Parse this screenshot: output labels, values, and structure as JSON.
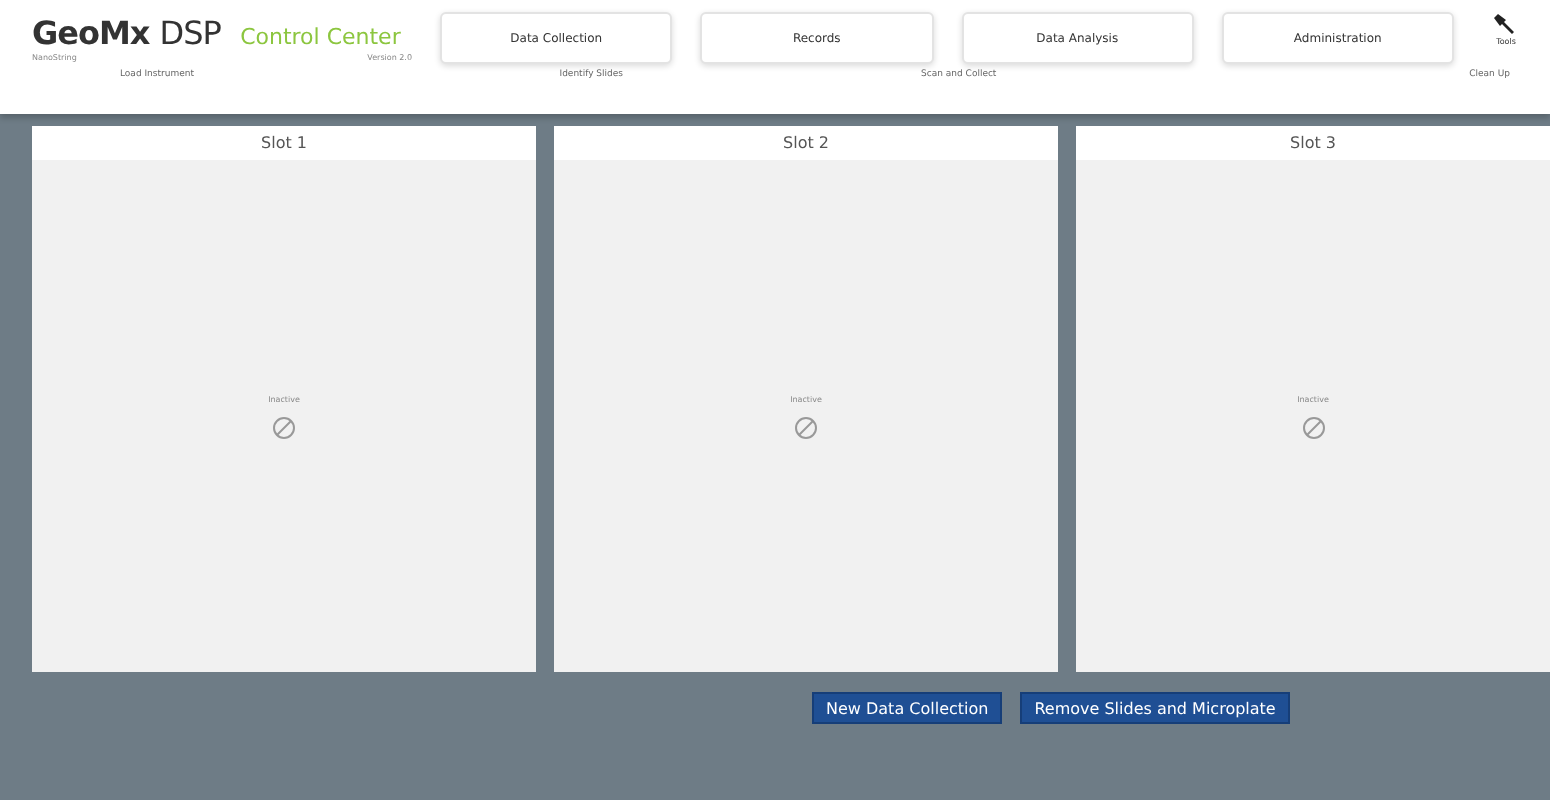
{
  "header": {
    "brand": "GeoMx",
    "product": "DSP",
    "app_name": "Control Center",
    "brand_subtitle": "NanoString",
    "version": "Version 2.0",
    "nav": [
      {
        "label": "Data Collection"
      },
      {
        "label": "Records"
      },
      {
        "label": "Data Analysis"
      },
      {
        "label": "Administration"
      }
    ],
    "tools": {
      "label": "Tools"
    },
    "steps": [
      {
        "label": "Load Instrument"
      },
      {
        "label": "Identify Slides"
      },
      {
        "label": "Scan and Collect"
      },
      {
        "label": "Clean Up"
      }
    ]
  },
  "slots": [
    {
      "title": "Slot 1",
      "status": "Inactive"
    },
    {
      "title": "Slot 2",
      "status": "Inactive"
    },
    {
      "title": "Slot 3",
      "status": "Inactive"
    }
  ],
  "actions": [
    {
      "label": "New Data Collection"
    },
    {
      "label": "Remove Slides and Microplate"
    }
  ]
}
